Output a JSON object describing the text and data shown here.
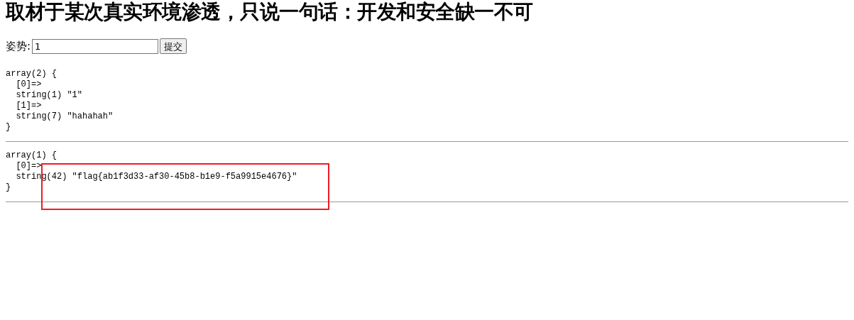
{
  "heading": "取材于某次真实环境渗透，只说一句话：开发和安全缺一不可",
  "form": {
    "label": "姿势:",
    "value": "1",
    "button": "提交"
  },
  "dumps": [
    {
      "lines": [
        "array(2) {",
        "  [0]=>",
        "  string(1) \"1\"",
        "  [1]=>",
        "  string(7) \"hahahah\"",
        "}"
      ],
      "highlighted": false
    },
    {
      "lines": [
        "array(1) {",
        "  [0]=>",
        "  string(42) \"flag{ab1f3d33-af30-45b8-b1e9-f5a9915e4676}\"",
        "}"
      ],
      "highlighted": true
    }
  ]
}
